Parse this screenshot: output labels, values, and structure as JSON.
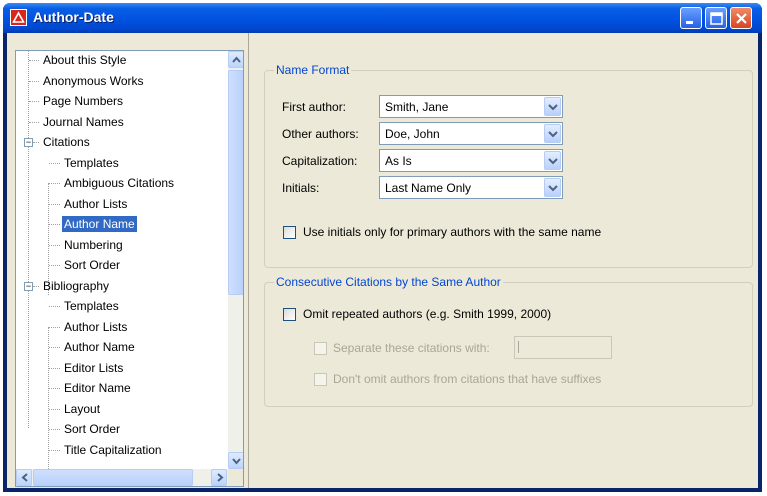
{
  "window": {
    "title": "Author-Date",
    "controls": {
      "minimize": "minimize-icon",
      "maximize": "maximize-icon",
      "close": "close-icon"
    }
  },
  "tree": {
    "items": [
      {
        "label": "About this Style",
        "level": 0
      },
      {
        "label": "Anonymous Works",
        "level": 0
      },
      {
        "label": "Page Numbers",
        "level": 0
      },
      {
        "label": "Journal Names",
        "level": 0
      },
      {
        "label": "Citations",
        "level": 0,
        "expander": "−"
      },
      {
        "label": "Templates",
        "level": 1
      },
      {
        "label": "Ambiguous Citations",
        "level": 1
      },
      {
        "label": "Author Lists",
        "level": 1
      },
      {
        "label": "Author Name",
        "level": 1,
        "selected": true
      },
      {
        "label": "Numbering",
        "level": 1
      },
      {
        "label": "Sort Order",
        "level": 1
      },
      {
        "label": "Bibliography",
        "level": 0,
        "expander": "−"
      },
      {
        "label": "Templates",
        "level": 1
      },
      {
        "label": "Author Lists",
        "level": 1
      },
      {
        "label": "Author Name",
        "level": 1
      },
      {
        "label": "Editor Lists",
        "level": 1
      },
      {
        "label": "Editor Name",
        "level": 1
      },
      {
        "label": "Layout",
        "level": 1
      },
      {
        "label": "Sort Order",
        "level": 1
      },
      {
        "label": "Title Capitalization",
        "level": 1
      }
    ]
  },
  "name_format": {
    "title": "Name Format",
    "first_author": {
      "label": "First author:",
      "value": "Smith, Jane"
    },
    "other_authors": {
      "label": "Other authors:",
      "value": "Doe, John"
    },
    "capitalization": {
      "label": "Capitalization:",
      "value": "As Is"
    },
    "initials": {
      "label": "Initials:",
      "value": "Last Name Only"
    },
    "use_initials_label": "Use initials only for primary authors with the same name"
  },
  "consecutive": {
    "title": "Consecutive Citations by the Same Author",
    "omit_repeated_label": "Omit repeated authors (e.g. Smith 1999, 2000)",
    "separate_label": "Separate these citations with:",
    "separate_value": ",",
    "dont_omit_label": "Don't omit authors from citations that have suffixes"
  }
}
